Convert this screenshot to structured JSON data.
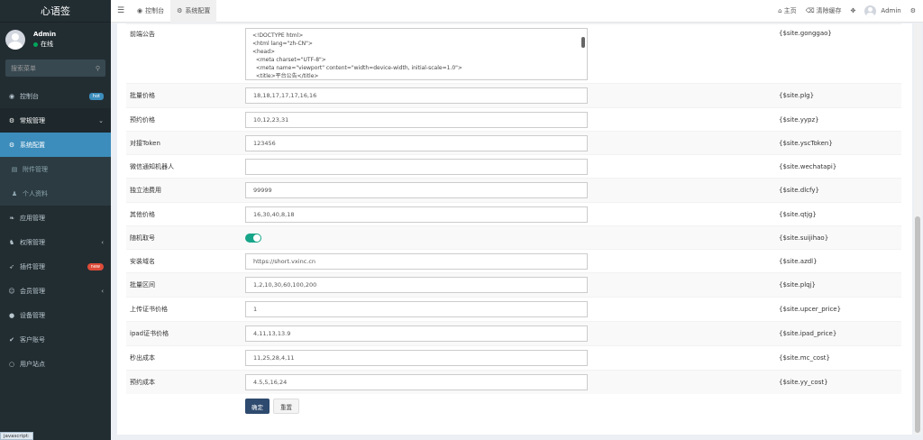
{
  "app": {
    "logo": "心语签"
  },
  "user": {
    "name": "Admin",
    "status": "在线"
  },
  "sidebar": {
    "search_placeholder": "搜索菜单",
    "items": [
      {
        "icon": "dashboard-icon",
        "glyph": "◉",
        "label": "控制台",
        "badge": "hot"
      },
      {
        "icon": "cogs-icon",
        "glyph": "⚙",
        "label": "常规管理",
        "arrow": "⌄"
      },
      {
        "icon": "gear-icon",
        "glyph": "⚙",
        "label": "系统配置"
      },
      {
        "icon": "attachment-icon",
        "glyph": "▤",
        "label": "附件管理"
      },
      {
        "icon": "user-icon",
        "glyph": "♟",
        "label": "个人资料"
      },
      {
        "icon": "leaf-icon",
        "glyph": "❧",
        "label": "应用管理"
      },
      {
        "icon": "group-icon",
        "glyph": "♞",
        "label": "权限管理",
        "arrow": "‹"
      },
      {
        "icon": "rocket-icon",
        "glyph": "➶",
        "label": "插件管理",
        "badge": "new"
      },
      {
        "icon": "member-icon",
        "glyph": "☺",
        "label": "会员管理",
        "arrow": "‹"
      },
      {
        "icon": "device-icon",
        "glyph": "●",
        "label": "设备管理"
      },
      {
        "icon": "check-icon",
        "glyph": "✔",
        "label": "客户账号"
      },
      {
        "icon": "circle-icon",
        "glyph": "○",
        "label": "用户站点"
      }
    ]
  },
  "topbar": {
    "tabs": [
      {
        "label": "控制台"
      },
      {
        "label": "系统配置"
      }
    ],
    "home": "主页",
    "clear_cache": "清除缓存",
    "admin": "Admin"
  },
  "config": {
    "announcement": {
      "label": "前端公告",
      "var": "{$site.gonggao}",
      "lines": [
        "<!DOCTYPE html>",
        "<html lang=\"zh-CN\">",
        "<head>",
        "  <meta charset=\"UTF-8\">",
        "  <meta name=\"viewport\" content=\"width=device-width, initial-scale=1.0\">",
        "  <title>平台公告</title>"
      ]
    },
    "rows": [
      {
        "label": "批量价格",
        "value": "18,18,17,17,17,16,16",
        "var": "{$site.plg}"
      },
      {
        "label": "预约价格",
        "value": "10,12,23,31",
        "var": "{$site.yypz}"
      },
      {
        "label": "对接Token",
        "value": "123456",
        "var": "{$site.yscToken}"
      },
      {
        "label": "微信通知机器人",
        "value": "",
        "var": "{$site.wechatapi}"
      },
      {
        "label": "独立池费用",
        "value": "99999",
        "var": "{$site.dlcfy}"
      },
      {
        "label": "其他价格",
        "value": "16,30,40,8,18",
        "var": "{$site.qtjg}"
      },
      {
        "label": "随机取号",
        "value": "",
        "toggle": true,
        "var": "{$site.suijihao}"
      },
      {
        "label": "安装域名",
        "value": "https://short.vxinc.cn",
        "var": "{$site.azdl}"
      },
      {
        "label": "批量区间",
        "value": "1,2,10,30,60,100,200",
        "var": "{$site.plqj}"
      },
      {
        "label": "上传证书价格",
        "value": "1",
        "var": "{$site.upcer_price}"
      },
      {
        "label": "ipad证书价格",
        "value": "4,11,13,13.9",
        "var": "{$site.ipad_price}"
      },
      {
        "label": "秒出成本",
        "value": "11,25,28,4,11",
        "var": "{$site.mc_cost}"
      },
      {
        "label": "预约成本",
        "value": "4.5,5,16,24",
        "var": "{$site.yy_cost}"
      }
    ],
    "submit": "确定",
    "reset": "重置"
  },
  "statusbar": "javascript:"
}
